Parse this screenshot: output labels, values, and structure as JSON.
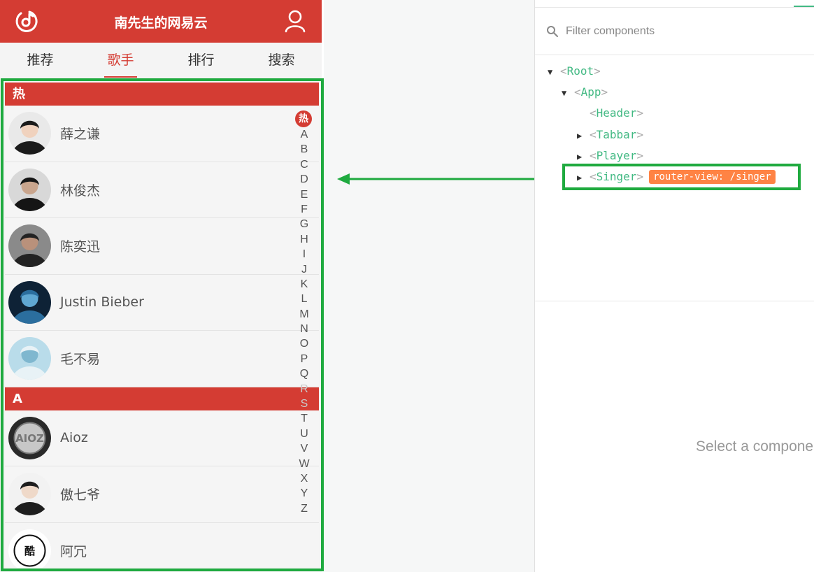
{
  "app": {
    "title": "南先生的网易云",
    "tabs": [
      "推荐",
      "歌手",
      "排行",
      "搜索"
    ],
    "active_tab": "歌手",
    "groups": [
      {
        "title": "热",
        "singers": [
          "薛之谦",
          "林俊杰",
          "陈奕迅",
          "Justin Bieber",
          "毛不易"
        ]
      },
      {
        "title": "A",
        "singers": [
          "Aioz",
          "傲七爷",
          "阿冗"
        ]
      }
    ],
    "index_hot": "热",
    "index_letters": [
      "A",
      "B",
      "C",
      "D",
      "E",
      "F",
      "G",
      "H",
      "I",
      "J",
      "K",
      "L",
      "M",
      "N",
      "O",
      "P",
      "Q",
      "R",
      "S",
      "T",
      "U",
      "V",
      "W",
      "X",
      "Y",
      "Z"
    ],
    "index_faded": [
      "R",
      "S"
    ],
    "avatar_labels": {
      "Aioz": "AIOZ",
      "阿冗": "酷"
    }
  },
  "devtools": {
    "filter_placeholder": "Filter components",
    "tree": [
      {
        "name": "Root",
        "caret": "▼"
      },
      {
        "name": "App",
        "caret": "▼"
      },
      {
        "name": "Header",
        "caret": ""
      },
      {
        "name": "Tabbar",
        "caret": "▶"
      },
      {
        "name": "Player",
        "caret": "▶"
      },
      {
        "name": "Singer",
        "caret": "▶",
        "badge": "router-view: /singer"
      }
    ],
    "empty_state": "Select a component"
  },
  "colors": {
    "brand_red": "#d43c33",
    "highlight_green": "#1faa3f",
    "vue_green": "#42b983",
    "badge_orange": "#ff8344"
  },
  "icons": {
    "logo": "netease-music-logo-icon",
    "user": "user-icon",
    "search": "search-icon"
  }
}
